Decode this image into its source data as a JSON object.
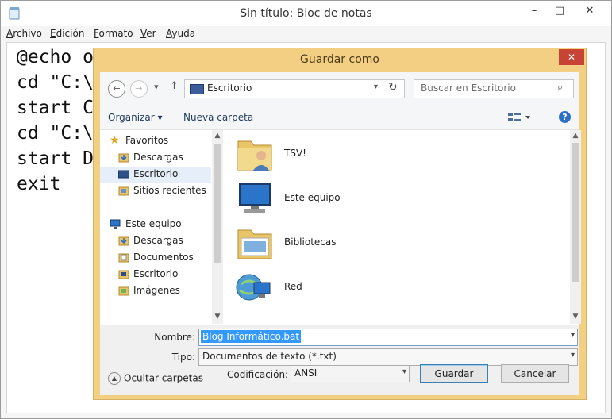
{
  "notepad": {
    "title": "Sin título: Bloc de notas",
    "controls": {
      "minimize": "–",
      "maximize": "□",
      "close": "✕"
    },
    "menu": [
      {
        "key": "A",
        "rest": "rchivo"
      },
      {
        "key": "E",
        "rest": "dición"
      },
      {
        "key": "F",
        "rest": "ormato"
      },
      {
        "key": "V",
        "rest": "er"
      },
      {
        "key": "A",
        "rest": "yuda"
      }
    ],
    "lines": [
      "@echo o",
      "cd \"C:\\",
      "start C",
      "cd \"C:\\",
      "start D",
      "exit"
    ]
  },
  "dialog": {
    "title": "Guardar como",
    "close": "✕",
    "address": "Escritorio",
    "search_placeholder": "Buscar en Escritorio",
    "toolbar": {
      "organize": "Organizar ▾",
      "new_folder": "Nueva carpeta",
      "help": "?"
    },
    "nav": [
      {
        "label": "Favoritos",
        "icon": "star-icon"
      },
      {
        "label": "Descargas",
        "icon": "downloads-icon"
      },
      {
        "label": "Escritorio",
        "icon": "desktop-icon"
      },
      {
        "label": "Sitios recientes",
        "icon": "recent-icon"
      },
      {
        "label": "Este equipo",
        "icon": "computer-icon"
      },
      {
        "label": "Descargas",
        "icon": "downloads-icon"
      },
      {
        "label": "Documentos",
        "icon": "documents-icon"
      },
      {
        "label": "Escritorio",
        "icon": "desktop-icon"
      },
      {
        "label": "Imágenes",
        "icon": "pictures-icon"
      }
    ],
    "files": [
      {
        "label": "TSV!",
        "icon": "user-folder-icon"
      },
      {
        "label": "Este equipo",
        "icon": "computer-icon"
      },
      {
        "label": "Bibliotecas",
        "icon": "libraries-icon"
      },
      {
        "label": "Red",
        "icon": "network-icon"
      }
    ],
    "form": {
      "name_label": "Nombre:",
      "name_value": "Blog Informático.bat",
      "type_label": "Tipo:",
      "type_value": "Documentos de texto (*.txt)",
      "encoding_label": "Codificación:",
      "encoding_value": "ANSI"
    },
    "hide_folders": "Ocultar carpetas",
    "save": "Guardar",
    "cancel": "Cancelar"
  }
}
